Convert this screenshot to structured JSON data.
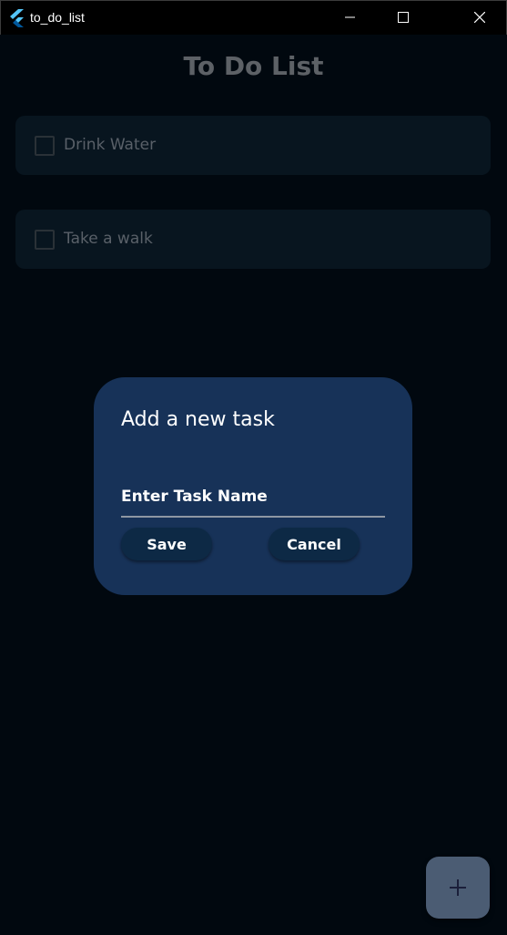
{
  "window": {
    "title": "to_do_list",
    "app_icon": "flutter-logo-icon",
    "controls": [
      "minimize-icon",
      "maximize-icon",
      "close-icon"
    ]
  },
  "page": {
    "title": "To Do List"
  },
  "tasks": [
    {
      "label": "Drink Water",
      "checked": false
    },
    {
      "label": "Take a walk",
      "checked": false
    }
  ],
  "dialog": {
    "title": "Add a new task",
    "input_placeholder": "Enter Task Name",
    "input_value": "",
    "save_label": "Save",
    "cancel_label": "Cancel"
  },
  "fab": {
    "icon": "plus-icon"
  },
  "colors": {
    "background": "#01080f",
    "card": "#08151f",
    "dialog": "#173258",
    "dialog_button": "#0d2945",
    "fab": "#4b5c73",
    "fab_icon": "#1b1f3a"
  }
}
